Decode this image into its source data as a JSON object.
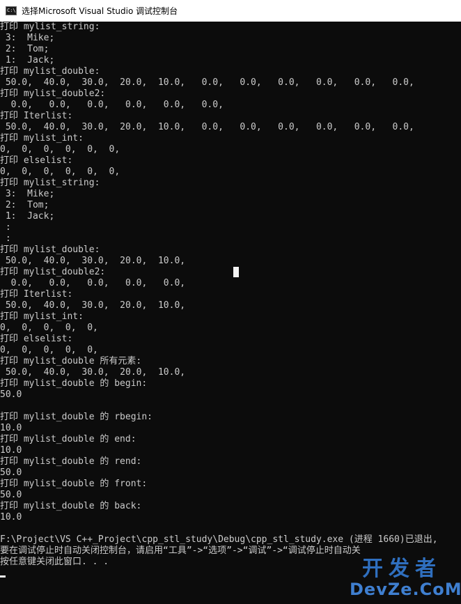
{
  "window": {
    "icon": "console-app-icon",
    "icon_text": "C:\\",
    "title": "选择Microsoft Visual Studio 调试控制台"
  },
  "console": {
    "lines": [
      "打印 mylist_string:",
      " 3:  Mike;",
      " 2:  Tom;",
      " 1:  Jack;",
      "打印 mylist_double:",
      " 50.0,  40.0,  30.0,  20.0,  10.0,   0.0,   0.0,   0.0,   0.0,   0.0,   0.0,",
      "打印 mylist_double2:",
      "  0.0,   0.0,   0.0,   0.0,   0.0,   0.0,",
      "打印 Iterlist:",
      " 50.0,  40.0,  30.0,  20.0,  10.0,   0.0,   0.0,   0.0,   0.0,   0.0,   0.0,",
      "打印 mylist_int:",
      "0,  0,  0,  0,  0,  0,",
      "打印 elselist:",
      "0,  0,  0,  0,  0,  0,",
      "打印 mylist_string:",
      " 3:  Mike;",
      " 2:  Tom;",
      " 1:  Jack;",
      " :",
      " :",
      "打印 mylist_double:",
      " 50.0,  40.0,  30.0,  20.0,  10.0,",
      "打印 mylist_double2:",
      "  0.0,   0.0,   0.0,   0.0,   0.0,",
      "打印 Iterlist:",
      " 50.0,  40.0,  30.0,  20.0,  10.0,",
      "打印 mylist_int:",
      "0,  0,  0,  0,  0,",
      "打印 elselist:",
      "0,  0,  0,  0,  0,",
      "打印 mylist_double 所有元素:",
      " 50.0,  40.0,  30.0,  20.0,  10.0,",
      "打印 mylist_double 的 begin:",
      "50.0",
      "",
      "打印 mylist_double 的 rbegin:",
      "10.0",
      "打印 mylist_double 的 end:",
      "10.0",
      "打印 mylist_double 的 rend:",
      "50.0",
      "打印 mylist_double 的 front:",
      "50.0",
      "打印 mylist_double 的 back:",
      "10.0",
      "",
      "F:\\Project\\VS C++_Project\\cpp_stl_study\\Debug\\cpp_stl_study.exe (进程 1660)已退出,",
      "要在调试停止时自动关闭控制台，请启用“工具”->“选项”->“调试”->“调试停止时自动关",
      "按任意键关闭此窗口. . ."
    ]
  },
  "watermark": {
    "cn": "开发者",
    "en": "DevZe.CoM"
  },
  "colors": {
    "console_bg": "#0c0c0c",
    "console_text": "#cccccc",
    "titlebar_bg": "#ffffff",
    "watermark": "#2f6fbf"
  }
}
